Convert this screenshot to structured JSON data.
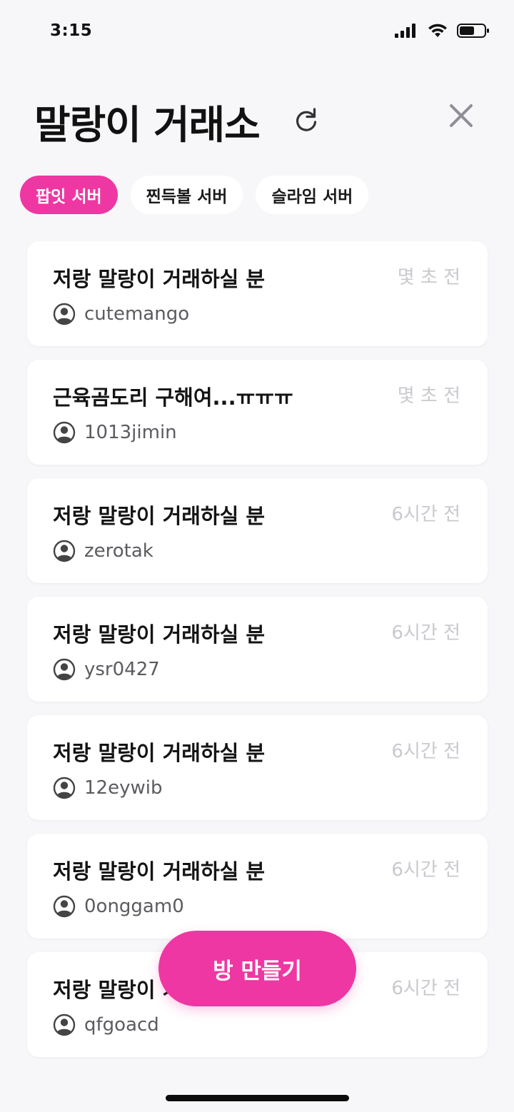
{
  "status_bar": {
    "time": "3:15",
    "icons": [
      "cellular-signal-icon",
      "wifi-icon",
      "battery-icon"
    ]
  },
  "header": {
    "title": "말랑이 거래소",
    "refresh_icon": "refresh-icon",
    "close_icon": "close-icon"
  },
  "servers": [
    {
      "label": "팝잇 서버",
      "active": true
    },
    {
      "label": "찐득볼 서버",
      "active": false
    },
    {
      "label": "슬라임 서버",
      "active": false
    }
  ],
  "rooms": [
    {
      "title": "저랑 말랑이 거래하실 분",
      "time": "몇 초 전",
      "username": "cutemango"
    },
    {
      "title": "근육곰도리 구해여...ㅠㅠㅠ",
      "time": "몇 초 전",
      "username": "1013jimin"
    },
    {
      "title": "저랑 말랑이 거래하실 분",
      "time": "6시간 전",
      "username": "zerotak"
    },
    {
      "title": "저랑 말랑이 거래하실 분",
      "time": "6시간 전",
      "username": "ysr0427"
    },
    {
      "title": "저랑 말랑이 거래하실 분",
      "time": "6시간 전",
      "username": "12eywib"
    },
    {
      "title": "저랑 말랑이 거래하실 분",
      "time": "6시간 전",
      "username": "0onggam0"
    },
    {
      "title": "저랑 말랑이 거래하실 분",
      "time": "6시간 전",
      "username": "qfgoacd"
    }
  ],
  "fab": {
    "label": "방 만들기"
  },
  "colors": {
    "accent": "#ee37a2",
    "background": "#f7f7fa",
    "card": "#ffffff",
    "muted_text": "#c9c9cf"
  }
}
